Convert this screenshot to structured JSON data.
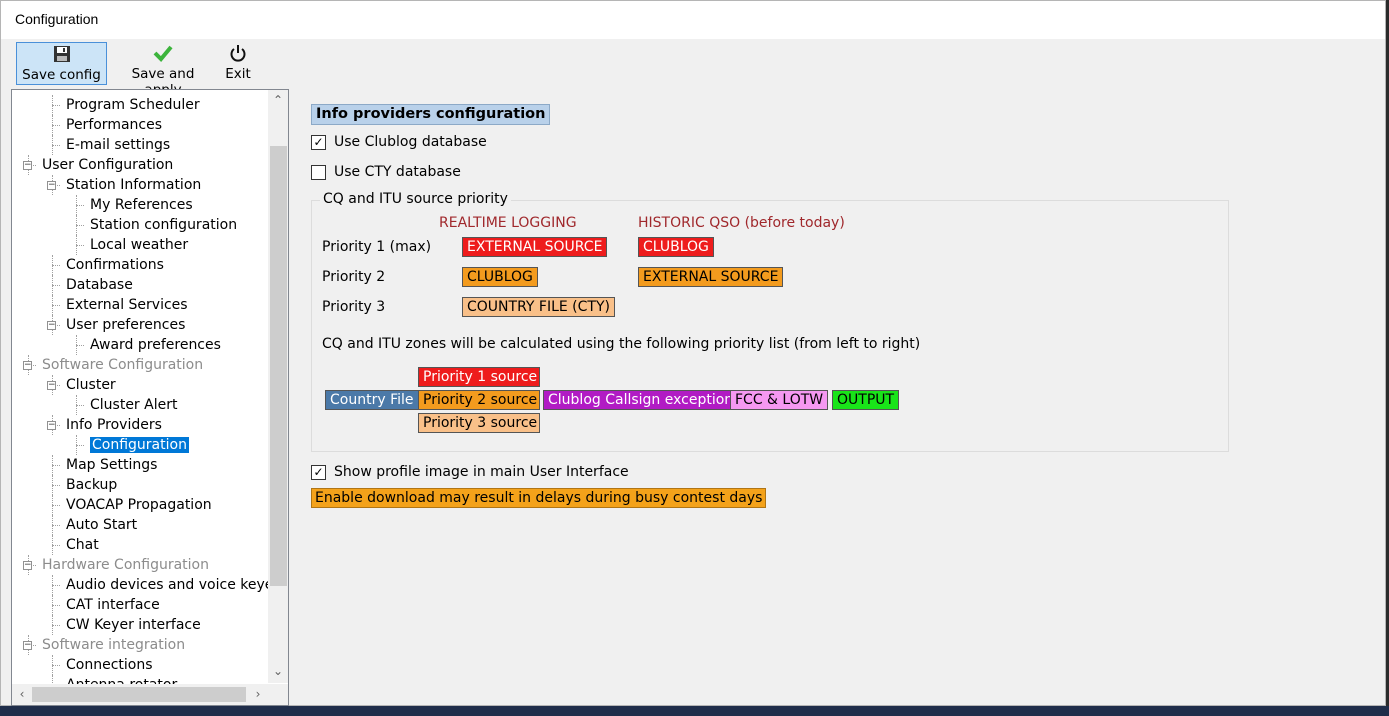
{
  "window": {
    "title": "Configuration"
  },
  "toolbar": {
    "save_config": "Save config",
    "save_apply": "Save and apply",
    "exit": "Exit",
    "icons": [
      "floppy-disk-icon",
      "green-check-icon",
      "power-icon"
    ]
  },
  "tree": {
    "items": [
      {
        "label": "Program Scheduler",
        "level": 2,
        "expander": "none"
      },
      {
        "label": "Performances",
        "level": 2,
        "expander": "none"
      },
      {
        "label": "E-mail settings",
        "level": 2,
        "expander": "none"
      },
      {
        "label": "User Configuration",
        "level": 1,
        "expander": "minus"
      },
      {
        "label": "Station Information",
        "level": 2,
        "expander": "minus"
      },
      {
        "label": "My References",
        "level": 3,
        "expander": "none"
      },
      {
        "label": "Station configuration",
        "level": 3,
        "expander": "none"
      },
      {
        "label": "Local weather",
        "level": 3,
        "expander": "none"
      },
      {
        "label": "Confirmations",
        "level": 2,
        "expander": "none"
      },
      {
        "label": "Database",
        "level": 2,
        "expander": "none"
      },
      {
        "label": "External Services",
        "level": 2,
        "expander": "none"
      },
      {
        "label": "User preferences",
        "level": 2,
        "expander": "minus"
      },
      {
        "label": "Award preferences",
        "level": 3,
        "expander": "none"
      },
      {
        "label": "Software Configuration",
        "level": 1,
        "expander": "minus",
        "gray": true
      },
      {
        "label": "Cluster",
        "level": 2,
        "expander": "minus"
      },
      {
        "label": "Cluster Alert",
        "level": 3,
        "expander": "none"
      },
      {
        "label": "Info Providers",
        "level": 2,
        "expander": "minus"
      },
      {
        "label": "Configuration",
        "level": 3,
        "expander": "none",
        "selected": true
      },
      {
        "label": "Map Settings",
        "level": 2,
        "expander": "none"
      },
      {
        "label": "Backup",
        "level": 2,
        "expander": "none"
      },
      {
        "label": "VOACAP Propagation",
        "level": 2,
        "expander": "none"
      },
      {
        "label": "Auto Start",
        "level": 2,
        "expander": "none"
      },
      {
        "label": "Chat",
        "level": 2,
        "expander": "none"
      },
      {
        "label": "Hardware Configuration",
        "level": 1,
        "expander": "minus",
        "gray": true
      },
      {
        "label": "Audio devices and voice keye",
        "level": 2,
        "expander": "none"
      },
      {
        "label": "CAT interface",
        "level": 2,
        "expander": "none"
      },
      {
        "label": "CW Keyer interface",
        "level": 2,
        "expander": "none"
      },
      {
        "label": "Software integration",
        "level": 1,
        "expander": "minus",
        "gray": true
      },
      {
        "label": "Connections",
        "level": 2,
        "expander": "none"
      },
      {
        "label": "Antenna rotator",
        "level": 2,
        "expander": "none"
      }
    ]
  },
  "panel": {
    "heading": "Info providers configuration",
    "use_clublog": {
      "label": "Use Clublog database",
      "checked": true
    },
    "use_cty": {
      "label": "Use CTY database",
      "checked": false
    },
    "group_title": "CQ and ITU source priority",
    "col_realtime": "REALTIME LOGGING",
    "col_historic": "HISTORIC QSO (before today)",
    "priorities": [
      {
        "label": "Priority 1 (max)",
        "realtime": "EXTERNAL SOURCE",
        "historic": "CLUBLOG"
      },
      {
        "label": "Priority 2",
        "realtime": "CLUBLOG",
        "historic": "EXTERNAL SOURCE"
      },
      {
        "label": "Priority 3",
        "realtime": "COUNTRY FILE (CTY)",
        "historic": ""
      }
    ],
    "flow_note": "CQ and ITU zones will be calculated using the following priority list (from left to right)",
    "flow": {
      "country_file": "Country File",
      "p1": "Priority 1 source",
      "p2": "Priority 2 source",
      "p3": "Priority 3 source",
      "clublog_exc": "Clublog Callsign exception",
      "fcc": "FCC & LOTW",
      "output": "OUTPUT"
    },
    "show_profile": {
      "label": "Show profile image in main User Interface",
      "checked": true
    },
    "warning": "Enable download may result in delays during busy contest days",
    "colors": {
      "red": "#ee1c1c",
      "orange": "#f39b1e",
      "peach": "#f9c089",
      "blue": "#4b79a8",
      "purple": "#b11bc4",
      "pink": "#f598f1",
      "green": "#19e419",
      "selection": "#0078d7"
    }
  }
}
